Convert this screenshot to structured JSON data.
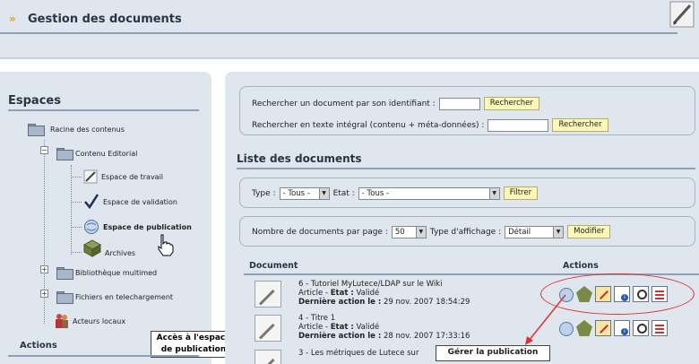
{
  "header": {
    "title": "Gestion des documents"
  },
  "left": {
    "title": "Espaces",
    "tree": {
      "root": "Racine des contenus",
      "editorial": "Contenu Editorial",
      "work": "Espace de travail",
      "validation": "Espace de validation",
      "publication": "Espace de publication",
      "archives": "Archives",
      "multimedia": "Bibliothèque multimed",
      "download": "Fichiers en telechargement",
      "actors": "Acteurs locaux"
    },
    "actions_title": "Actions",
    "callout_line1": "Accès à l'espace",
    "callout_line2": "de publication"
  },
  "search": {
    "by_id_label": "Rechercher un document par son identifiant :",
    "by_id_button": "Rechercher",
    "fulltext_label": "Rechercher en texte intégral (contenu + méta-données) :",
    "fulltext_button": "Rechercher"
  },
  "list": {
    "title": "Liste des documents",
    "type_label": "Type :",
    "type_value": "- Tous -",
    "etat_label": "Etat :",
    "etat_value": "- Tous -",
    "filter_button": "Filtrer",
    "per_page_label": "Nombre de documents par page :",
    "per_page_value": "50",
    "display_label": "Type d'affichage :",
    "display_value": "Détail",
    "modify_button": "Modifier",
    "col_document": "Document",
    "col_actions": "Actions",
    "rows": [
      {
        "title": "6 - Tutoriel MyLutece/LDAP sur le Wiki",
        "meta_prefix": "Article - ",
        "state_label": "Etat :",
        "state_value": " Validé",
        "last_label": "Dernière action le :",
        "last_value": " 29 nov. 2007 18:54:29"
      },
      {
        "title": "4 - Titre 1",
        "meta_prefix": "Article - ",
        "state_label": "Etat :",
        "state_value": " Validé",
        "last_label": "Dernière action le :",
        "last_value": " 28 nov. 2007 17:33:16"
      },
      {
        "title": "3 - Les métriques de Lutece sur"
      }
    ],
    "callout_manage": "Gérer la publication"
  }
}
